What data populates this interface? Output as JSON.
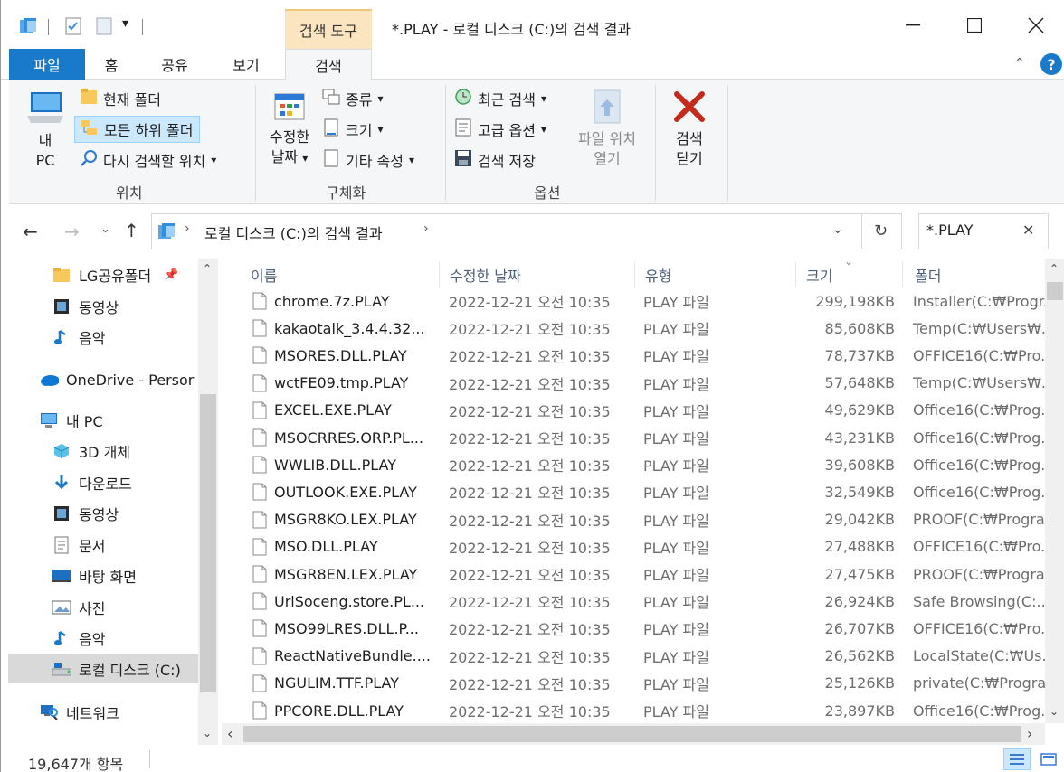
{
  "window": {
    "search_tools_label": "검색 도구",
    "title": "*.PLAY - 로컬 디스크 (C:)의 검색 결과"
  },
  "tabs": {
    "file": "파일",
    "home": "홈",
    "share": "공유",
    "view": "보기",
    "search": "검색"
  },
  "ribbon": {
    "location": {
      "pc_line1": "내",
      "pc_line2": "PC",
      "current_folder": "현재 폴더",
      "all_subfolders": "모든 하위 폴더",
      "search_again_in": "다시 검색할 위치",
      "group_label": "위치"
    },
    "refine": {
      "date_modified_line1": "수정한",
      "date_modified_line2": "날짜",
      "kind": "종류",
      "size": "크기",
      "other_properties": "기타 속성",
      "group_label": "구체화"
    },
    "options": {
      "recent_searches": "최근 검색",
      "advanced_options": "고급 옵션",
      "save_search": "검색 저장",
      "open_file_location_line1": "파일 위치",
      "open_file_location_line2": "열기",
      "group_label": "옵션"
    },
    "close": {
      "line1": "검색",
      "line2": "닫기"
    }
  },
  "address": {
    "path": "로컬 디스크 (C:)의 검색 결과"
  },
  "search": {
    "value": "*.PLAY"
  },
  "nav": {
    "items": [
      {
        "label": "LG공유폴더",
        "icon": "folder-icon"
      },
      {
        "label": "동영상",
        "icon": "video-icon"
      },
      {
        "label": "음악",
        "icon": "music-icon"
      },
      {
        "label": "OneDrive - Persor",
        "icon": "onedrive-icon"
      },
      {
        "label": "내 PC",
        "icon": "pc-icon"
      },
      {
        "label": "3D 개체",
        "icon": "3d-objects-icon"
      },
      {
        "label": "다운로드",
        "icon": "downloads-icon"
      },
      {
        "label": "동영상",
        "icon": "video-icon"
      },
      {
        "label": "문서",
        "icon": "documents-icon"
      },
      {
        "label": "바탕 화면",
        "icon": "desktop-icon"
      },
      {
        "label": "사진",
        "icon": "pictures-icon"
      },
      {
        "label": "음악",
        "icon": "music-icon"
      },
      {
        "label": "로컬 디스크 (C:)",
        "icon": "drive-icon"
      },
      {
        "label": "네트워크",
        "icon": "network-icon"
      }
    ]
  },
  "columns": {
    "name": "이름",
    "date": "수정한 날짜",
    "type": "유형",
    "size": "크기",
    "folder": "폴더"
  },
  "files": [
    {
      "name": "chrome.7z.PLAY",
      "date": "2022-12-21 오전 10:35",
      "type": "PLAY 파일",
      "size": "299,198KB",
      "folder": "Installer(C:₩Progr..."
    },
    {
      "name": "kakaotalk_3.4.4.32...",
      "date": "2022-12-21 오전 10:35",
      "type": "PLAY 파일",
      "size": "85,608KB",
      "folder": "Temp(C:₩Users₩..."
    },
    {
      "name": "MSORES.DLL.PLAY",
      "date": "2022-12-21 오전 10:35",
      "type": "PLAY 파일",
      "size": "78,737KB",
      "folder": "OFFICE16(C:₩Pro..."
    },
    {
      "name": "wctFE09.tmp.PLAY",
      "date": "2022-12-21 오전 10:35",
      "type": "PLAY 파일",
      "size": "57,648KB",
      "folder": "Temp(C:₩Users₩..."
    },
    {
      "name": "EXCEL.EXE.PLAY",
      "date": "2022-12-21 오전 10:35",
      "type": "PLAY 파일",
      "size": "49,629KB",
      "folder": "Office16(C:₩Prog..."
    },
    {
      "name": "MSOCRRES.ORP.PL...",
      "date": "2022-12-21 오전 10:35",
      "type": "PLAY 파일",
      "size": "43,231KB",
      "folder": "Office16(C:₩Prog..."
    },
    {
      "name": "WWLIB.DLL.PLAY",
      "date": "2022-12-21 오전 10:35",
      "type": "PLAY 파일",
      "size": "39,608KB",
      "folder": "Office16(C:₩Prog..."
    },
    {
      "name": "OUTLOOK.EXE.PLAY",
      "date": "2022-12-21 오전 10:35",
      "type": "PLAY 파일",
      "size": "32,549KB",
      "folder": "Office16(C:₩Prog..."
    },
    {
      "name": "MSGR8KO.LEX.PLAY",
      "date": "2022-12-21 오전 10:35",
      "type": "PLAY 파일",
      "size": "29,042KB",
      "folder": "PROOF(C:₩Progra..."
    },
    {
      "name": "MSO.DLL.PLAY",
      "date": "2022-12-21 오전 10:35",
      "type": "PLAY 파일",
      "size": "27,488KB",
      "folder": "OFFICE16(C:₩Pro..."
    },
    {
      "name": "MSGR8EN.LEX.PLAY",
      "date": "2022-12-21 오전 10:35",
      "type": "PLAY 파일",
      "size": "27,475KB",
      "folder": "PROOF(C:₩Progra..."
    },
    {
      "name": "UrlSoceng.store.PL...",
      "date": "2022-12-21 오전 10:35",
      "type": "PLAY 파일",
      "size": "26,924KB",
      "folder": "Safe Browsing(C:..."
    },
    {
      "name": "MSO99LRES.DLL.P...",
      "date": "2022-12-21 오전 10:35",
      "type": "PLAY 파일",
      "size": "26,707KB",
      "folder": "OFFICE16(C:₩Pro..."
    },
    {
      "name": "ReactNativeBundle....",
      "date": "2022-12-21 오전 10:35",
      "type": "PLAY 파일",
      "size": "26,562KB",
      "folder": "LocalState(C:₩Us..."
    },
    {
      "name": "NGULIM.TTF.PLAY",
      "date": "2022-12-21 오전 10:35",
      "type": "PLAY 파일",
      "size": "25,126KB",
      "folder": "private(C:₩Progra..."
    },
    {
      "name": "PPCORE.DLL.PLAY",
      "date": "2022-12-21 오전 10:35",
      "type": "PLAY 파일",
      "size": "23,897KB",
      "folder": "Office16(C:₩Prog..."
    }
  ],
  "status": {
    "item_count": "19,647개 항목"
  },
  "colors": {
    "file_tab": "#1979ca",
    "search_tools": "#fbe5c1",
    "selected_nav": "#cce8ff",
    "close_x": "#c42b1c"
  }
}
